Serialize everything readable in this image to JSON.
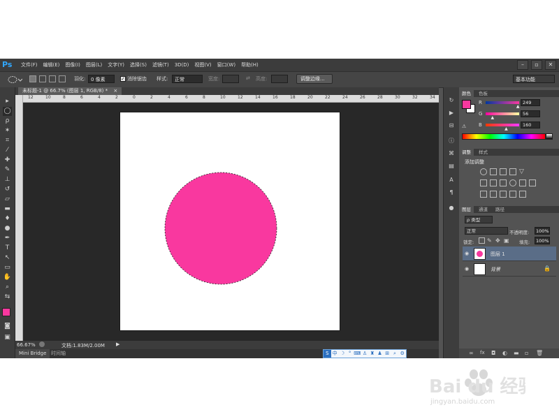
{
  "app": {
    "logo": "Ps",
    "menu": [
      "文件(F)",
      "编辑(E)",
      "图像(I)",
      "图层(L)",
      "文字(Y)",
      "选择(S)",
      "滤镜(T)",
      "3D(D)",
      "视图(V)",
      "窗口(W)",
      "帮助(H)"
    ],
    "window_controls": [
      "–",
      "▫",
      "✕"
    ]
  },
  "options_bar": {
    "feather_label": "羽化:",
    "feather_value": "0 像素",
    "antialias_label": "消除锯齿",
    "antialias_checked": true,
    "style_label": "样式:",
    "style_value": "正常",
    "width_label": "宽度:",
    "height_label": "高度:",
    "refine_button": "调整边缘...",
    "workspace": "基本功能"
  },
  "document": {
    "tab_title": "未标题-1 @ 66.7% (图层 1, RGB/8) *",
    "close": "×",
    "circle_color": "#f9389f"
  },
  "ruler": {
    "top_labels": [
      "12",
      "10",
      "8",
      "6",
      "4",
      "2",
      "0",
      "2",
      "4",
      "6",
      "8",
      "10",
      "12",
      "14",
      "16",
      "18",
      "20",
      "22",
      "24",
      "26",
      "28",
      "30",
      "32",
      "34"
    ]
  },
  "status": {
    "zoom": "66.67%",
    "doc_size": "文档:1.83M/2.00M"
  },
  "bottom_tabs": [
    "Mini Bridge",
    "时间轴"
  ],
  "ime": {
    "lang": "中"
  },
  "color_panel": {
    "tabs": [
      "颜色",
      "色板"
    ],
    "foreground": "#f9389f",
    "background": "#ffffff",
    "channels": [
      {
        "name": "R",
        "value": "249",
        "fraction": 0.976
      },
      {
        "name": "G",
        "value": "56",
        "fraction": 0.22
      },
      {
        "name": "B",
        "value": "160",
        "fraction": 0.627
      }
    ]
  },
  "adjustments_panel": {
    "tabs": [
      "调整",
      "样式"
    ],
    "title": "添加调整"
  },
  "layers_panel": {
    "tabs": [
      "图层",
      "通道",
      "路径"
    ],
    "filter_label": "ρ 类型",
    "blend_mode": "正常",
    "opacity_label": "不透明度:",
    "opacity_value": "100%",
    "lock_label": "锁定:",
    "fill_label": "填充:",
    "fill_value": "100%",
    "layers": [
      {
        "name": "图层 1",
        "selected": true
      },
      {
        "name": "背景",
        "selected": false
      }
    ]
  },
  "watermark": {
    "brand": "Bai du 经验",
    "url": "jingyan.baidu.com"
  }
}
